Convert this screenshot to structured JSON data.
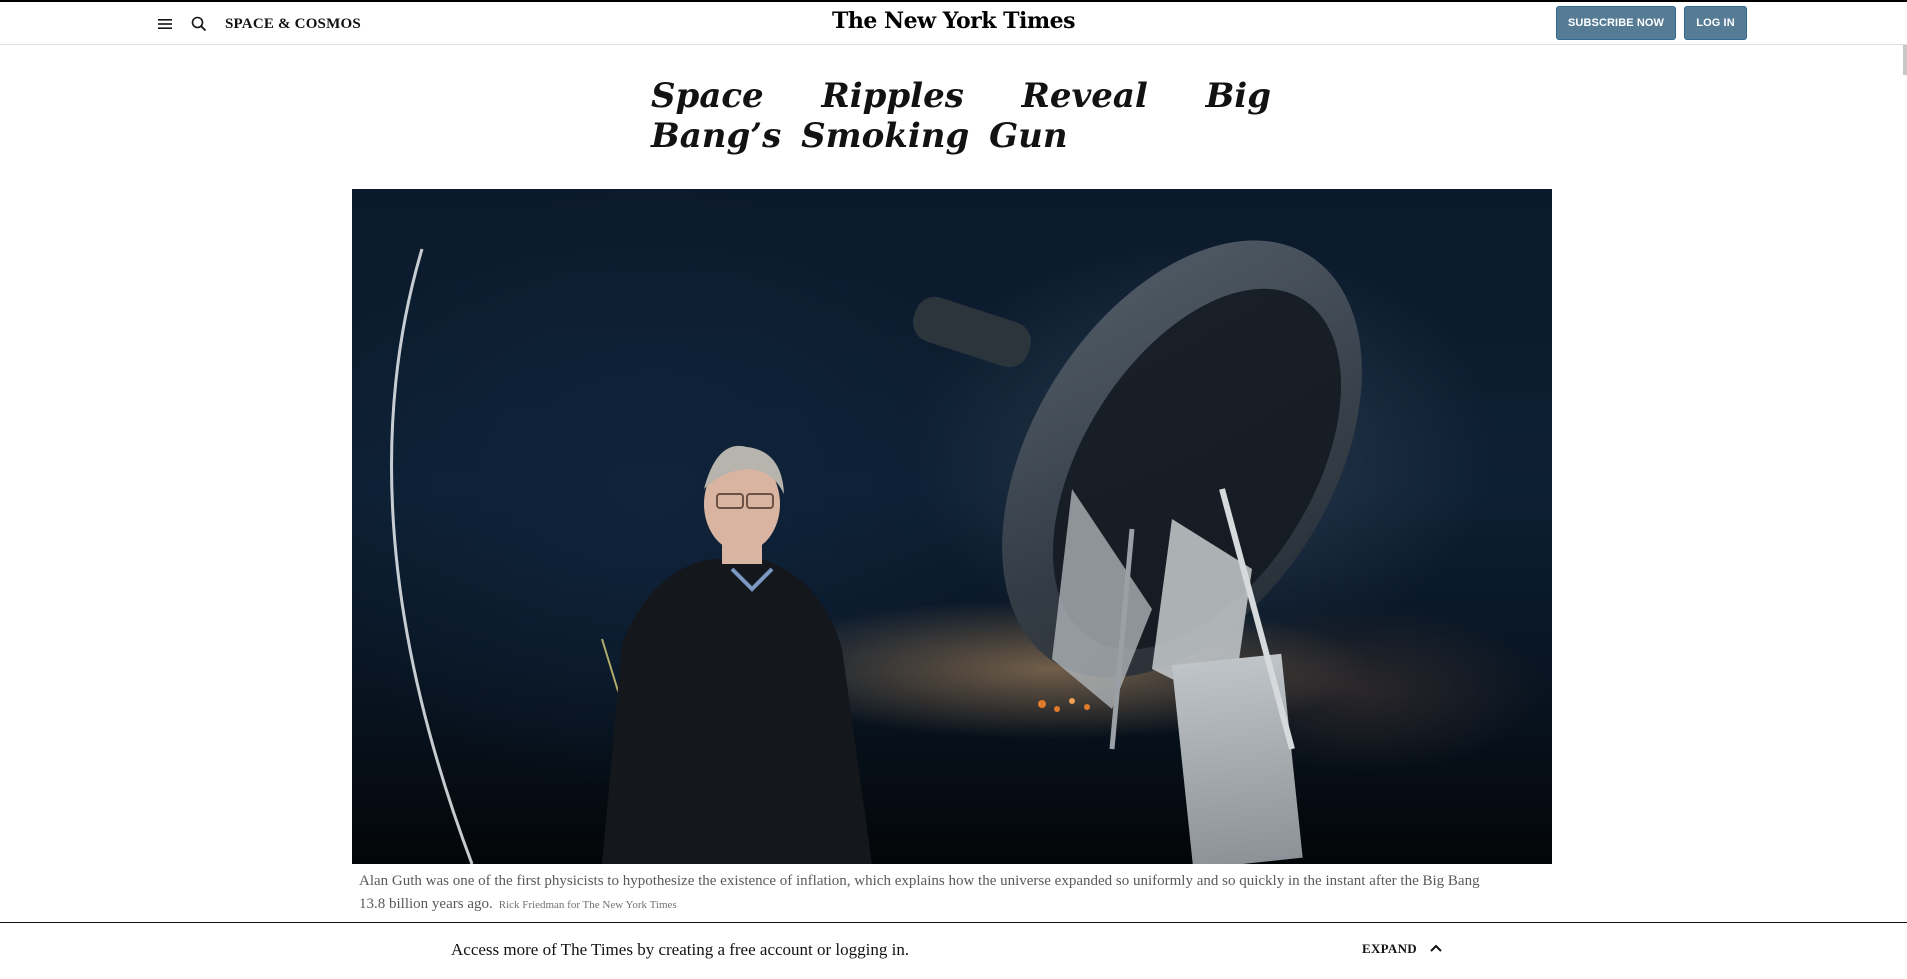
{
  "header": {
    "section": "SPACE & COSMOS",
    "logo": "The New York Times",
    "subscribe_label": "SUBSCRIBE NOW",
    "login_label": "LOG IN",
    "icons": [
      "menu-icon",
      "search-icon"
    ]
  },
  "article": {
    "headline": "Space Ripples Reveal Big Bang’s Smoking Gun",
    "image_description_icon": "hero-photo",
    "caption": "Alan Guth was one of the first physicists to hypothesize the existence of inflation, which explains how the universe expanded so uniformly and so quickly in the instant after the Big Bang 13.8 billion years ago.",
    "credit": "Rick Friedman for The New York Times"
  },
  "drawer": {
    "message": "Access more of The Times by creating a free account or logging in.",
    "expand_label": "EXPAND",
    "icon": "chevron-up-icon"
  },
  "colors": {
    "button_bg": "#567b95",
    "text": "#121212",
    "caption": "#5a5a5a"
  }
}
